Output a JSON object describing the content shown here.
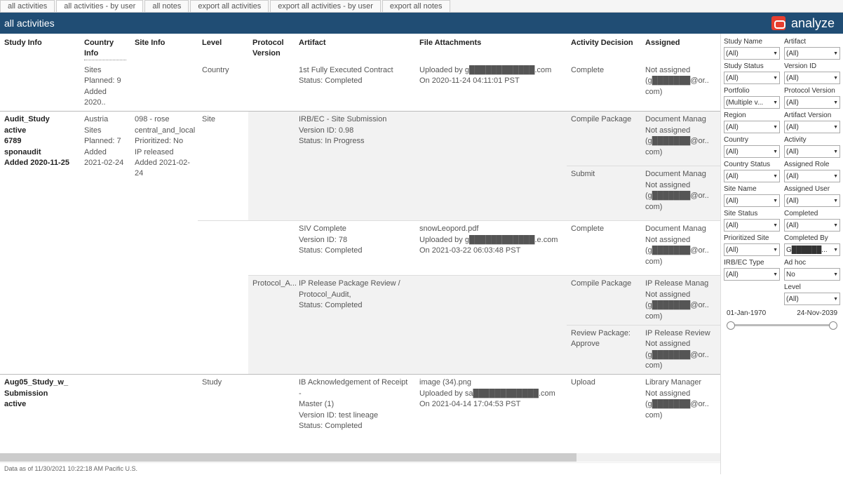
{
  "tabs": [
    {
      "label": "all activities"
    },
    {
      "label": "all activities - by user"
    },
    {
      "label": "all notes"
    },
    {
      "label": "export all activities"
    },
    {
      "label": "export all activities - by user"
    },
    {
      "label": "export all notes"
    }
  ],
  "activeTab": 1,
  "header": {
    "title": "all activities",
    "brand": "analyze"
  },
  "columns": {
    "studyInfo": "Study Info",
    "countryInfo": "Country Info",
    "siteInfo": "Site Info",
    "level": "Level",
    "protocolVersion": "Protocol Version",
    "artifact": "Artifact",
    "fileAttachments": "File Attachments",
    "activityDecision": "Activity Decision",
    "assigned": "Assigned"
  },
  "rows": {
    "r0": {
      "country": {
        "l1": "Sites",
        "l2": "Planned: 9",
        "l3": "Added 2020.."
      },
      "level": "Country",
      "artifact": {
        "l1": "1st Fully Executed Contract",
        "l2": "Status: Completed"
      },
      "file": {
        "l1": "Uploaded by g████████████.com",
        "l2": "On 2020-11-24 04:11:01 PST"
      },
      "decision": "Complete",
      "assigned": {
        "l1": "Not assigned",
        "l2": "(g███████@or..",
        "l3": "com)"
      }
    },
    "r1": {
      "study": {
        "l1": "Audit_Study",
        "l2": "active",
        "l3": "6789",
        "l4": "sponaudit",
        "l5": "Added 2020-11-25"
      },
      "country": {
        "l1": "Austria",
        "l2": "Sites",
        "l3": "Planned: 7",
        "l4": "Added",
        "l5": "2021-02-24"
      },
      "site": {
        "l1": "098 - rose",
        "l2": "central_and_local",
        "l3": "Prioritized: No",
        "l4": "IP released",
        "l5": "Added 2021-02-24"
      },
      "level": "Site",
      "artifact": {
        "l1": "IRB/EC - Site Submission",
        "l2": "Version ID: 0.98",
        "l3": "Status: In Progress"
      },
      "decision_a": "Compile Package",
      "assigned_a": {
        "l1": "Document Manag",
        "l2": "Not assigned",
        "l3": "(g███████@or..",
        "l4": "com)"
      },
      "decision_b": "Submit",
      "assigned_b": {
        "l1": "Document Manag",
        "l2": "Not assigned",
        "l3": "(g███████@or..",
        "l4": "com)"
      }
    },
    "r2": {
      "artifact": {
        "l1": "SIV Complete",
        "l2": "Version ID: 78",
        "l3": "Status: Completed"
      },
      "file": {
        "l1": "snowLeopord.pdf",
        "l2": "Uploaded by g████████████.e.com",
        "l3": "On 2021-03-22 06:03:48 PST"
      },
      "decision": "Complete",
      "assigned": {
        "l1": "Document Manag",
        "l2": "Not assigned",
        "l3": "(g███████@or..",
        "l4": "com)"
      }
    },
    "r3": {
      "protocol": "Protocol_A...",
      "artifact": {
        "l1": "IP Release Package Review /",
        "l2": "Protocol_Audit,",
        "l3": "Status: Completed"
      },
      "decision_a": "Compile Package",
      "assigned_a": {
        "l1": "IP Release Manag",
        "l2": "Not assigned",
        "l3": "(g███████@or..",
        "l4": "com)"
      },
      "decision_b": "Review Package: Approve",
      "assigned_b": {
        "l1": "IP Release Review",
        "l2": "Not assigned",
        "l3": "(g███████@or..",
        "l4": "com)"
      }
    },
    "r4": {
      "study": {
        "l1": "Aug05_Study_w_",
        "l2": "Submission",
        "l3": "active"
      },
      "level": "Study",
      "artifact": {
        "l1": "IB Acknowledgement of Receipt -",
        "l2": "Master (1)",
        "l3": "Version ID: test lineage",
        "l4": "Status: Completed"
      },
      "file": {
        "l1": "image (34).png",
        "l2": "Uploaded by sa████████████.com",
        "l3": "On 2021-04-14 17:04:53 PST"
      },
      "decision": "Upload",
      "assigned": {
        "l1": "Library Manager",
        "l2": "Not assigned",
        "l3": "(g███████@or..",
        "l4": "com)"
      }
    }
  },
  "filters": {
    "studyName": {
      "label": "Study Name",
      "value": "(All)"
    },
    "artifact": {
      "label": "Artifact",
      "value": "(All)"
    },
    "studyStatus": {
      "label": "Study Status",
      "value": "(All)"
    },
    "versionId": {
      "label": "Version ID",
      "value": "(All)"
    },
    "portfolio": {
      "label": "Portfolio",
      "value": "(Multiple v..."
    },
    "protocolVersion": {
      "label": "Protocol Version",
      "value": "(All)"
    },
    "region": {
      "label": "Region",
      "value": "(All)"
    },
    "artifactVersion": {
      "label": "Artifact Version",
      "value": "(All)"
    },
    "country": {
      "label": "Country",
      "value": "(All)"
    },
    "activity": {
      "label": "Activity",
      "value": "(All)"
    },
    "countryStatus": {
      "label": "Country Status",
      "value": "(All)"
    },
    "assignedRole": {
      "label": "Assigned Role",
      "value": "(All)"
    },
    "siteName": {
      "label": "Site Name",
      "value": "(All)"
    },
    "assignedUser": {
      "label": "Assigned User",
      "value": "(All)"
    },
    "siteStatus": {
      "label": "Site Status",
      "value": "(All)"
    },
    "completed": {
      "label": "Completed",
      "value": "(All)"
    },
    "prioritizedSite": {
      "label": "Prioritized Site",
      "value": "(All)"
    },
    "completedBy": {
      "label": "Completed By",
      "value": "G██████..."
    },
    "irbEcType": {
      "label": "IRB/EC Type",
      "value": "(All)"
    },
    "adHoc": {
      "label": "Ad hoc",
      "value": "No"
    },
    "level": {
      "label": "Level",
      "value": "(All)"
    },
    "dateStart": "01-Jan-1970",
    "dateEnd": "24-Nov-2039"
  },
  "footer": "Data as of 11/30/2021 10:22:18 AM Pacific U.S."
}
